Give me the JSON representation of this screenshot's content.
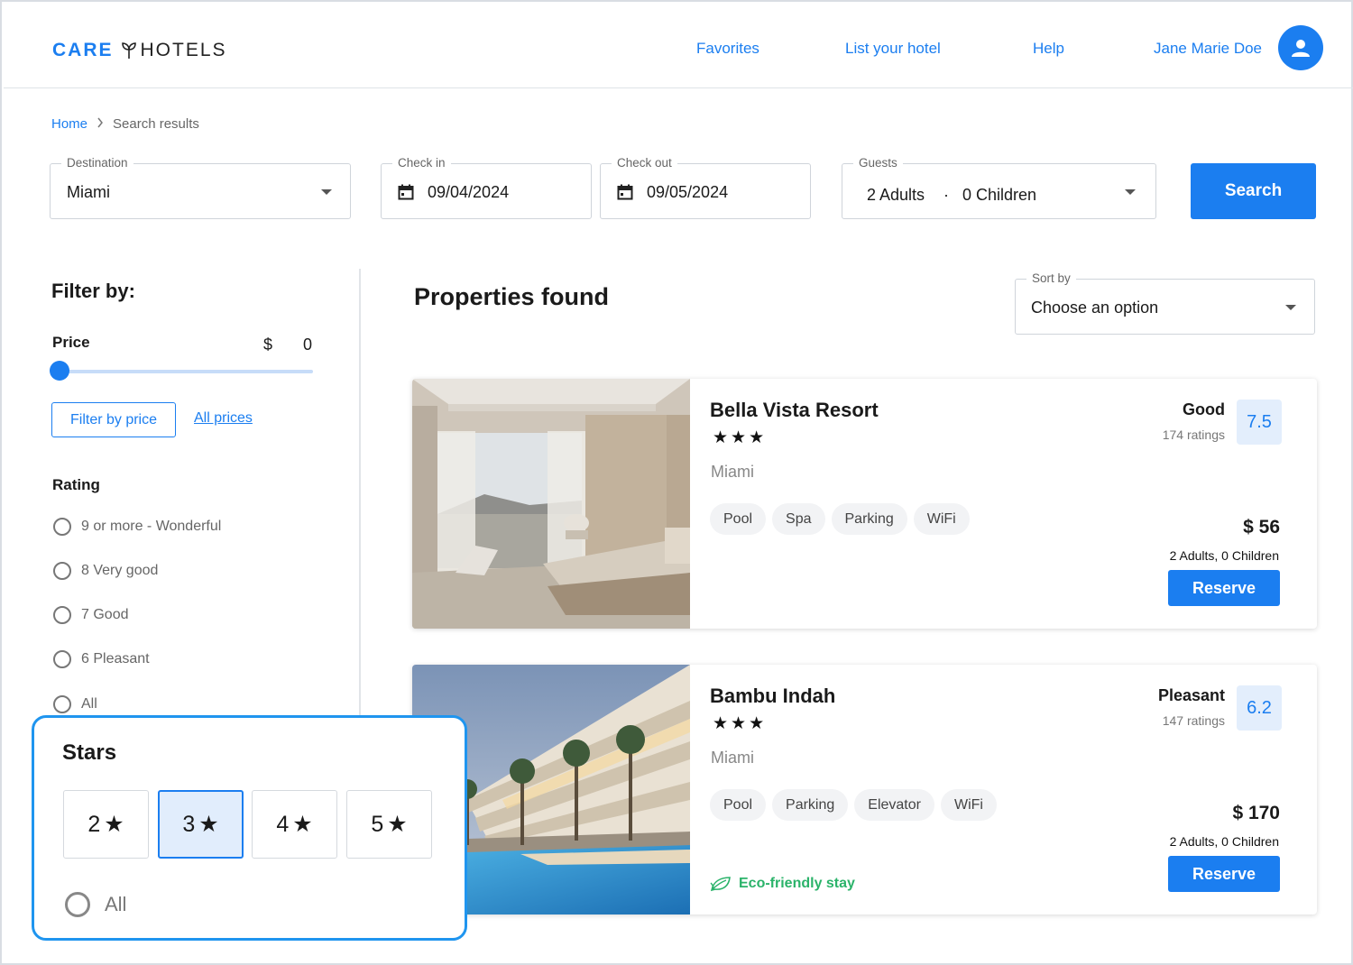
{
  "header": {
    "logo_care": "CARE",
    "logo_hotels": "HOTELS",
    "nav": [
      "Favorites",
      "List your hotel",
      "Help",
      "Jane Marie Doe"
    ]
  },
  "breadcrumb": {
    "home": "Home",
    "current": "Search results"
  },
  "search": {
    "destination_label": "Destination",
    "destination_value": "Miami",
    "checkin_label": "Check in",
    "checkin_value": "09/04/2024",
    "checkout_label": "Check out",
    "checkout_value": "09/05/2024",
    "guests_label": "Guests",
    "guests_adults": "2 Adults",
    "guests_sep": "·",
    "guests_children": "0 Children",
    "button": "Search"
  },
  "filters": {
    "title": "Filter by:",
    "price_label": "Price",
    "price_currency": "$",
    "price_value": "0",
    "price_slider_fraction": 0,
    "filter_price_button": "Filter by price",
    "all_prices_link": "All prices",
    "rating_title": "Rating",
    "rating_options": [
      "9 or more -  Wonderful",
      "8 Very good",
      "7 Good",
      "6 Pleasant",
      "All"
    ]
  },
  "stars_panel": {
    "title": "Stars",
    "options": [
      "2",
      "3",
      "4",
      "5"
    ],
    "selected": "3",
    "star_glyph": "★",
    "all_label": "All"
  },
  "results": {
    "title": "Properties found",
    "sort_label": "Sort by",
    "sort_value": "Choose an option",
    "hotels": [
      {
        "name": "Bella Vista Resort",
        "stars": "★★★",
        "city": "Miami",
        "amenities": [
          "Pool",
          "Spa",
          "Parking",
          "WiFi"
        ],
        "rating_word": "Good",
        "ratings_count": "174 ratings",
        "score": "7.5",
        "price": "$  56",
        "occupancy": "2 Adults,  0 Children",
        "reserve": "Reserve"
      },
      {
        "name": "Bambu Indah",
        "stars": "★★★",
        "city": "Miami",
        "amenities": [
          "Pool",
          "Parking",
          "Elevator",
          "WiFi"
        ],
        "rating_word": "Pleasant",
        "ratings_count": "147 ratings",
        "score": "6.2",
        "price": "$ 170",
        "occupancy": "2 Adults,  0 Children",
        "reserve": "Reserve",
        "eco": "Eco-friendly stay"
      }
    ]
  },
  "colors": {
    "accent": "#1b7ef0",
    "eco": "#2bb36a",
    "panel_border": "#1f95ef"
  }
}
